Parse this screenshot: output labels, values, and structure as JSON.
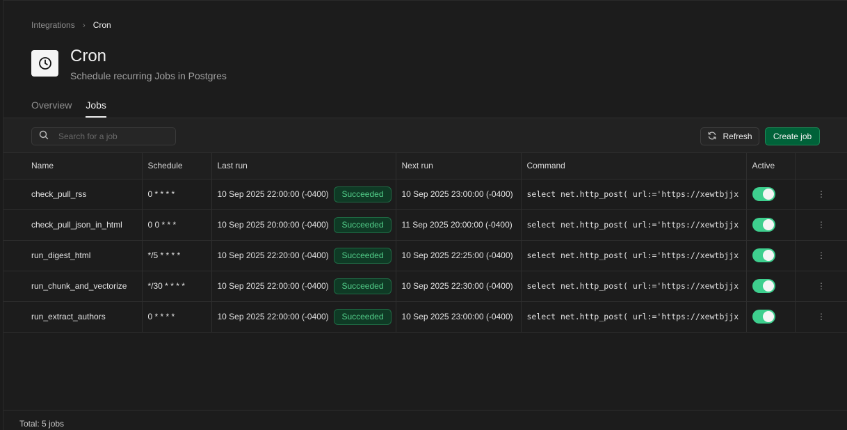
{
  "breadcrumb": {
    "parent": "Integrations",
    "separator": "›",
    "current": "Cron"
  },
  "header": {
    "title": "Cron",
    "subtitle": "Schedule recurring Jobs in Postgres"
  },
  "tabs": [
    {
      "label": "Overview",
      "active": false
    },
    {
      "label": "Jobs",
      "active": true
    }
  ],
  "toolbar": {
    "search_placeholder": "Search for a job",
    "refresh_label": "Refresh",
    "create_label": "Create job"
  },
  "table": {
    "columns": [
      "Name",
      "Schedule",
      "Last run",
      "Next run",
      "Command",
      "Active"
    ],
    "rows": [
      {
        "name": "check_pull_rss",
        "schedule": "0 * * * *",
        "last_run": "10 Sep 2025 22:00:00 (-0400)",
        "status": "Succeeded",
        "next_run": "10 Sep 2025 23:00:00 (-0400)",
        "command": "select net.http_post( url:='https://xewtbjjx",
        "active": true
      },
      {
        "name": "check_pull_json_in_html",
        "schedule": "0 0 * * *",
        "last_run": "10 Sep 2025 20:00:00 (-0400)",
        "status": "Succeeded",
        "next_run": "11 Sep 2025 20:00:00 (-0400)",
        "command": "select net.http_post( url:='https://xewtbjjx",
        "active": true
      },
      {
        "name": "run_digest_html",
        "schedule": "*/5 * * * *",
        "last_run": "10 Sep 2025 22:20:00 (-0400)",
        "status": "Succeeded",
        "next_run": "10 Sep 2025 22:25:00 (-0400)",
        "command": "select net.http_post( url:='https://xewtbjjx",
        "active": true
      },
      {
        "name": "run_chunk_and_vectorize",
        "schedule": "*/30 * * * *",
        "last_run": "10 Sep 2025 22:00:00 (-0400)",
        "status": "Succeeded",
        "next_run": "10 Sep 2025 22:30:00 (-0400)",
        "command": "select net.http_post( url:='https://xewtbjjx",
        "active": true
      },
      {
        "name": "run_extract_authors",
        "schedule": "0 * * * *",
        "last_run": "10 Sep 2025 22:00:00 (-0400)",
        "status": "Succeeded",
        "next_run": "10 Sep 2025 23:00:00 (-0400)",
        "command": "select net.http_post( url:='https://xewtbjjx",
        "active": true
      }
    ]
  },
  "footer": {
    "total": "Total: 5 jobs"
  },
  "colors": {
    "accent": "#3ecf8e",
    "primary_button": "#006239",
    "status_text": "#53d08b",
    "background": "#1c1c1c"
  },
  "icons": {
    "app": "clock-icon",
    "search": "search-icon",
    "refresh": "refresh-icon",
    "row_menu": "kebab-icon"
  }
}
